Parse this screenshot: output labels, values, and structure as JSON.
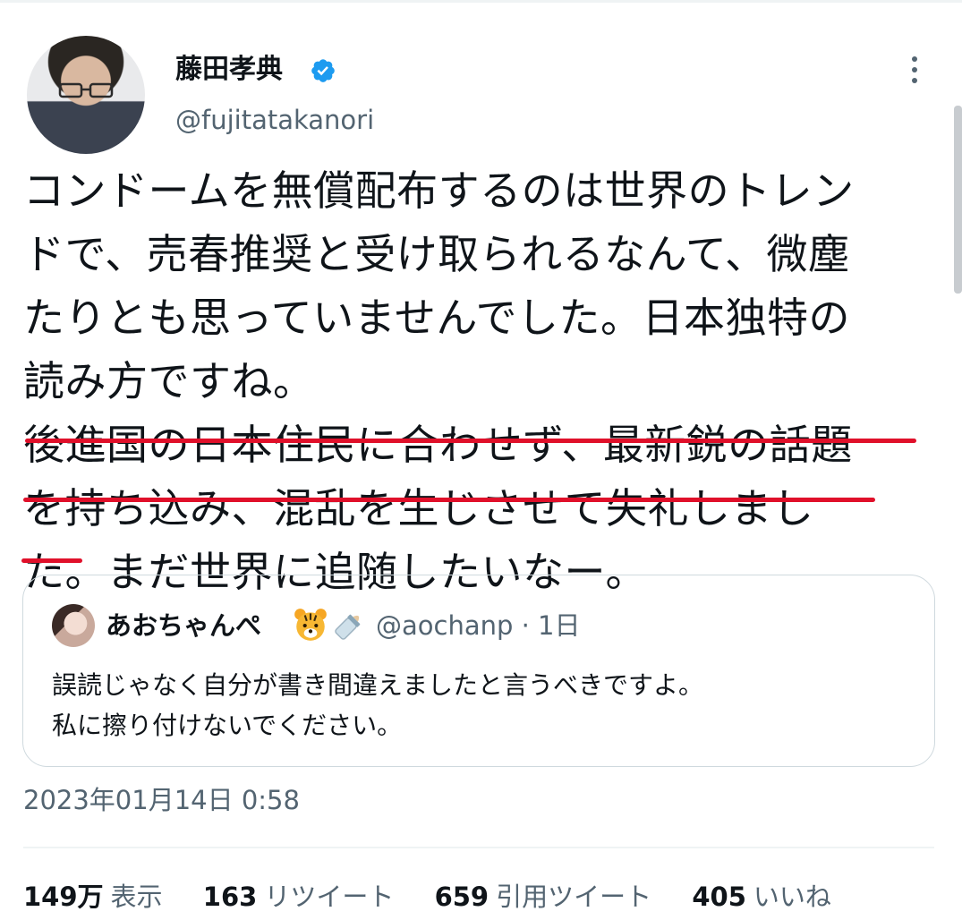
{
  "author": {
    "display_name": "藤田孝典",
    "handle": "@fujitatakanori"
  },
  "tweet": {
    "lines": [
      "コンドームを無償配布するのは世界のトレン",
      "ドで、売春推奨と受け取られるなんて、微塵",
      "たりとも思っていませんでした。日本独特の",
      "読み方ですね。",
      "後進国の日本住民に合わせず、最新鋭の話題",
      "を持ち込み、混乱を生じさせて失礼しまし",
      "た。まだ世界に追随したいなー。"
    ]
  },
  "quote": {
    "display_name": "あおちゃんぺ",
    "handle_date": "@aochanp · 1日",
    "text_line1": "誤読じゃなく自分が書き間違えましたと言うべきですよ。",
    "text_line2": "私に擦り付けないでください。"
  },
  "timestamp": "2023年01月14日 0:58",
  "stats": {
    "views_num": "149万",
    "views_label": "表示",
    "retweets_num": "163",
    "retweets_label": "リツイート",
    "quotes_num": "659",
    "quotes_label": "引用ツイート",
    "likes_num": "405",
    "likes_label": "いいね"
  },
  "colors": {
    "verified": "#1d9bf0",
    "underline": "#e0102a",
    "secondary_text": "#536471"
  }
}
